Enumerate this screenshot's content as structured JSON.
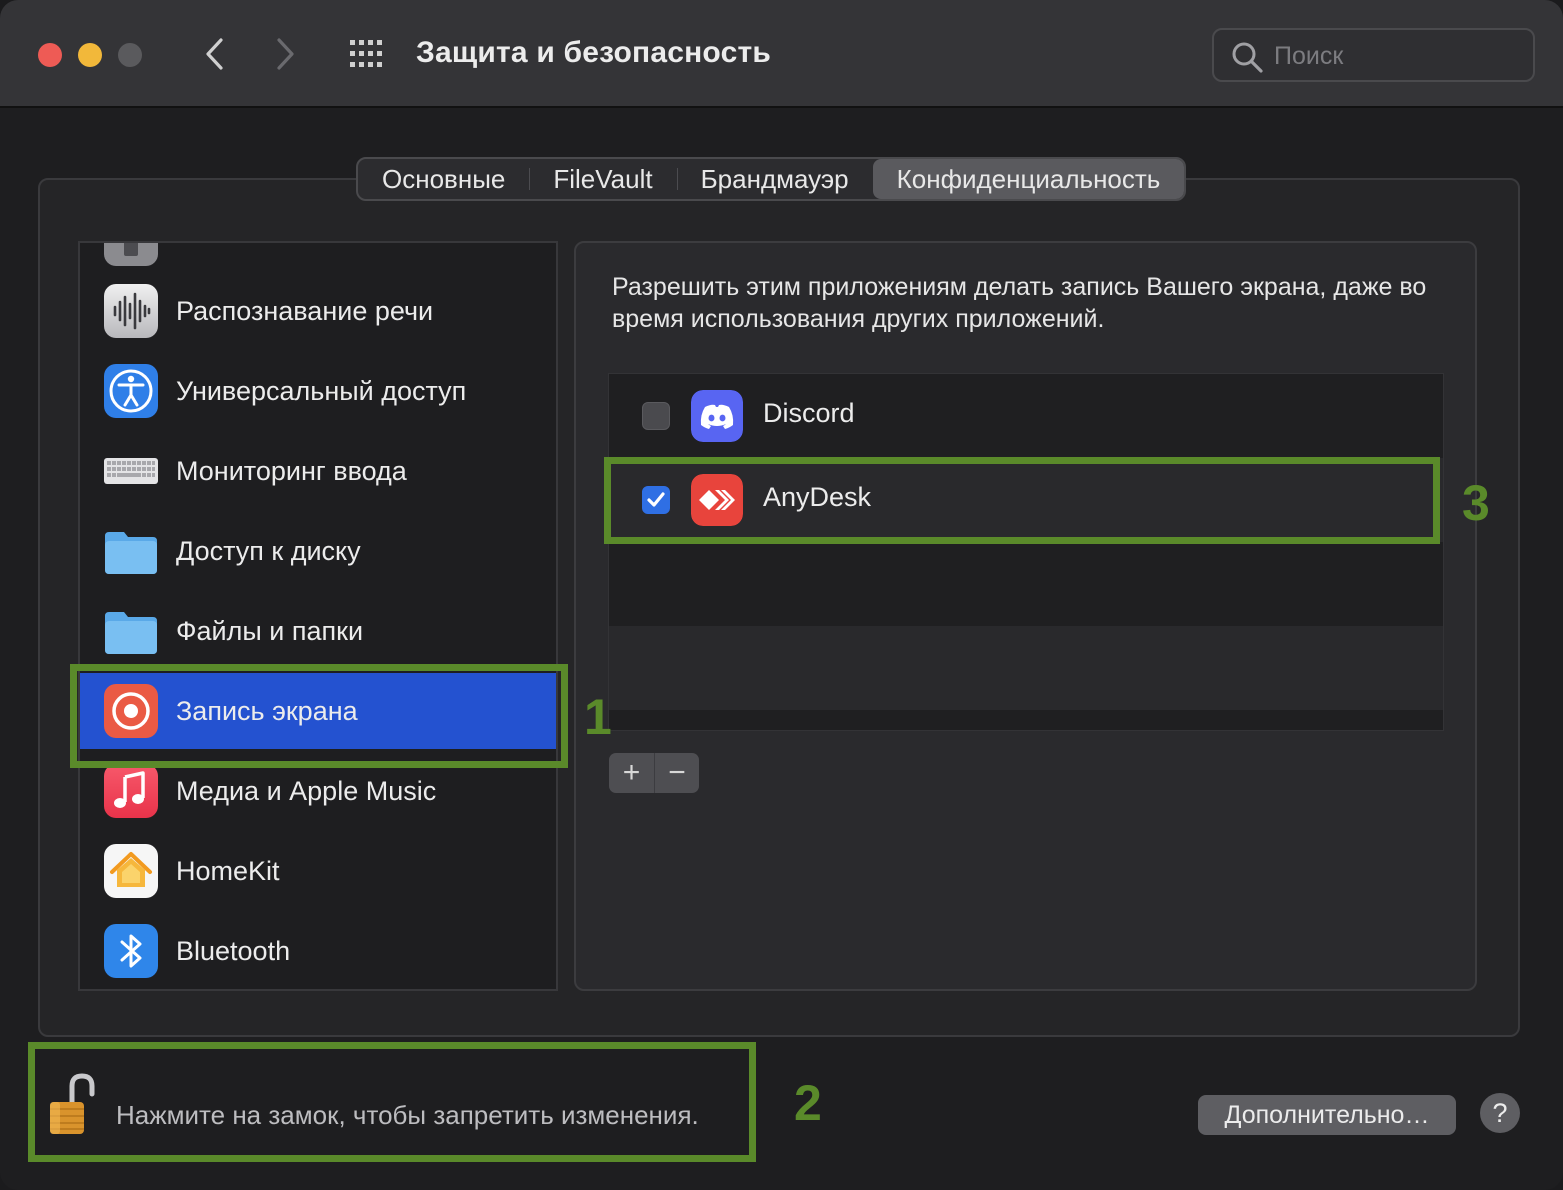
{
  "window": {
    "title": "Защита и безопасность",
    "search_placeholder": "Поиск"
  },
  "tabs": [
    {
      "label": "Основные",
      "active": false
    },
    {
      "label": "FileVault",
      "active": false
    },
    {
      "label": "Брандмауэр",
      "active": false
    },
    {
      "label": "Конфиденциальность",
      "active": true
    }
  ],
  "sidebar": {
    "items": [
      {
        "label": "Распознавание речи",
        "icon": "speech-recognition-icon"
      },
      {
        "label": "Универсальный доступ",
        "icon": "accessibility-icon"
      },
      {
        "label": "Мониторинг ввода",
        "icon": "keyboard-icon"
      },
      {
        "label": "Доступ к диску",
        "icon": "folder-icon"
      },
      {
        "label": "Файлы и папки",
        "icon": "folder-icon"
      },
      {
        "label": "Запись экрана",
        "icon": "screen-record-icon",
        "selected": true
      },
      {
        "label": "Медиа и Apple Music",
        "icon": "music-icon"
      },
      {
        "label": "HomeKit",
        "icon": "home-icon"
      },
      {
        "label": "Bluetooth",
        "icon": "bluetooth-icon"
      }
    ]
  },
  "content": {
    "description": "Разрешить этим приложениям делать запись Вашего экрана, даже во время использования других приложений.",
    "apps": [
      {
        "name": "Discord",
        "checked": false,
        "icon": "discord-icon"
      },
      {
        "name": "AnyDesk",
        "checked": true,
        "icon": "anydesk-icon"
      }
    ],
    "add_label": "+",
    "remove_label": "−"
  },
  "footer": {
    "lock_text": "Нажмите на замок, чтобы запретить изменения.",
    "advanced_label": "Дополнительно…",
    "help_label": "?"
  },
  "annotations": {
    "marker_1": "1",
    "marker_2": "2",
    "marker_3": "3"
  },
  "colors": {
    "selection": "#2452d0",
    "annotation": "#5a8a2a",
    "checkbox_checked": "#2f6fe4"
  }
}
